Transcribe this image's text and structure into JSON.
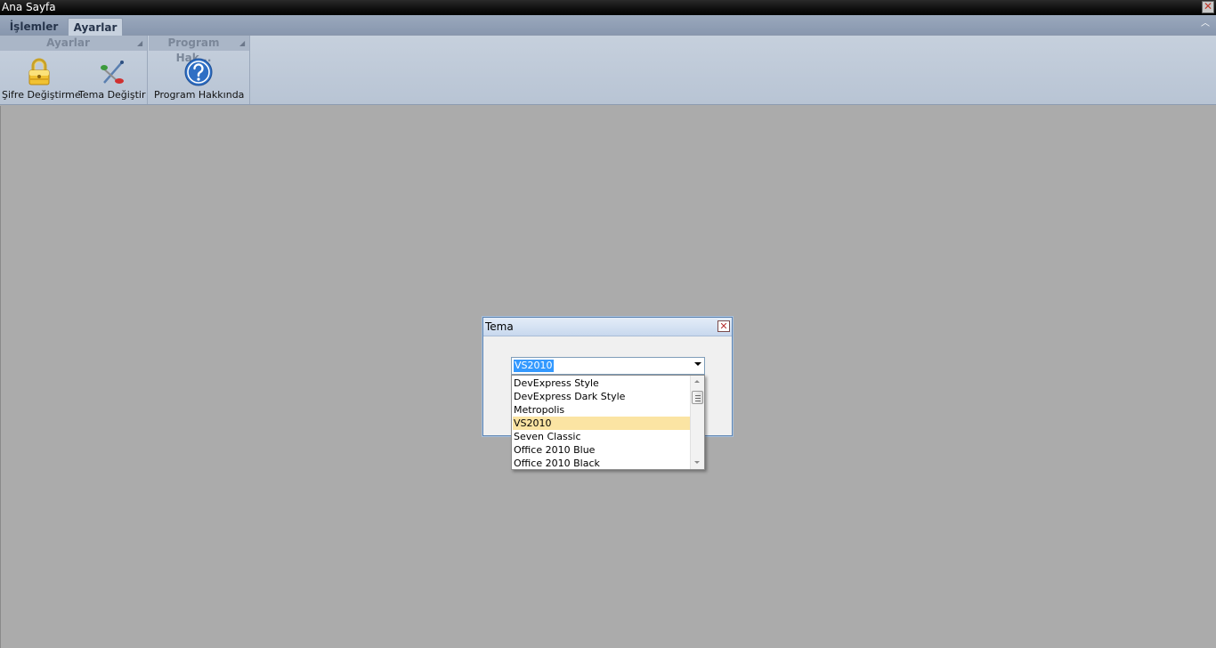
{
  "window": {
    "title": "Ana Sayfa",
    "close_glyph": "✕"
  },
  "ribbon": {
    "tabs": [
      {
        "label": "İşlemler",
        "active": false
      },
      {
        "label": "Ayarlar",
        "active": true
      }
    ],
    "collapse_glyph": "︿",
    "groups": [
      {
        "title": "Ayarlar",
        "buttons": [
          {
            "label": "Şifre Değiştirme",
            "icon": "lock-icon"
          },
          {
            "label": "Tema Değiştir",
            "icon": "paint-brush-icon"
          }
        ]
      },
      {
        "title": "Program Hak...",
        "buttons": [
          {
            "label": "Program Hakkında",
            "icon": "help-icon"
          }
        ]
      }
    ],
    "expand_glyph": "◢"
  },
  "dialog": {
    "title": "Tema",
    "close_glyph": "✕",
    "combo_value": "VS2010",
    "options": [
      "DevExpress Style",
      "DevExpress Dark Style",
      "Metropolis",
      "VS2010",
      "Seven Classic",
      "Office 2010 Blue",
      "Office 2010 Black"
    ],
    "selected_index": 3
  },
  "colors": {
    "workarea": "#ababab",
    "ribbon": "#c6d0dd",
    "selection_highlight": "#fbe4a3",
    "text_selection": "#3399ff"
  }
}
